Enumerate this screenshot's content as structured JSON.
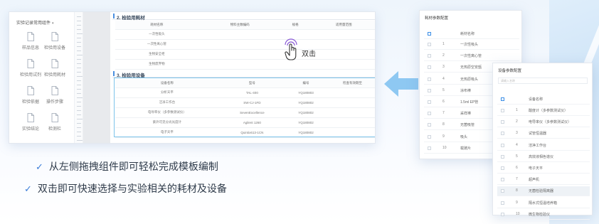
{
  "palette": {
    "title": "实验记录常用组件",
    "items": [
      {
        "label": "样品信息"
      },
      {
        "label": "检验用设备"
      },
      {
        "label": "检验用试剂"
      },
      {
        "label": "检验用耗材"
      },
      {
        "label": "检验依据"
      },
      {
        "label": "操作步骤"
      },
      {
        "label": "实验结论"
      },
      {
        "label": "检测栏"
      }
    ]
  },
  "doc": {
    "section2_title": "2. 检验用耗材",
    "section2_headers": [
      "耗材名称",
      "物料主数编码",
      "规格",
      "适用量范围"
    ],
    "section2_rows": [
      "一次性吸头",
      "一次性离心管",
      "生物安全柜",
      "生物废弃物"
    ],
    "section3_title": "3. 检验用设备",
    "section3_headers": [
      "设备名称",
      "型号",
      "编号",
      "检查有效期至"
    ],
    "section3_rows": [
      [
        "分析天平",
        "TAL-400",
        "YQ180803"
      ],
      [
        "洁净工作台",
        "SW-CJ-1FD",
        "YQ180802"
      ],
      [
        "电导率仪（多参数测试仪）",
        "SevenExcellence",
        "YQ180802"
      ],
      [
        "紫外可见分光光度计",
        "Agilent 1260",
        "YQ180802"
      ],
      [
        "电子天平",
        "Quintix613-1CN",
        "YQ180802"
      ]
    ]
  },
  "hint": {
    "dblclick_label": "双击"
  },
  "consumables_panel": {
    "title": "耗材参数配置",
    "header": "耗材名称",
    "items": [
      {
        "num": "1",
        "name": "一次性吸头"
      },
      {
        "num": "2",
        "name": "一次性离心管"
      },
      {
        "num": "3",
        "name": "无热原空安瓿"
      },
      {
        "num": "4",
        "name": "无热原吸头"
      },
      {
        "num": "5",
        "name": "涂布棒"
      },
      {
        "num": "6",
        "name": "1.5ml EP管"
      },
      {
        "num": "7",
        "name": "采样棒"
      },
      {
        "num": "8",
        "name": "无菌吸管"
      },
      {
        "num": "9",
        "name": "吸头"
      },
      {
        "num": "10",
        "name": "载玻片"
      }
    ]
  },
  "equipment_panel": {
    "title": "设备参数配置",
    "search_placeholder": "请输入名称",
    "header": "设备名称",
    "items": [
      {
        "num": "1",
        "name": "酸度计（多参数测试仪）"
      },
      {
        "num": "2",
        "name": "电导率仪（多参数测试仪）"
      },
      {
        "num": "3",
        "name": "试管恒温器"
      },
      {
        "num": "4",
        "name": "洁净工作台"
      },
      {
        "num": "5",
        "name": "高效液相色谱仪"
      },
      {
        "num": "6",
        "name": "电子天平"
      },
      {
        "num": "7",
        "name": "超声机"
      },
      {
        "num": "8",
        "name": "无菌检验隔离器"
      },
      {
        "num": "9",
        "name": "隔水式恒温培养箱"
      },
      {
        "num": "10",
        "name": "微生物检验仪"
      }
    ]
  },
  "features": [
    "从左侧拖拽组件即可轻松完成模板编制",
    "双击即可快速选择与实验相关的耗材及设备"
  ],
  "check_glyph": "✓",
  "colors": {
    "accent": "#3b7dd8",
    "selection": "#7cc3ea",
    "arrow": "#8ec8f2",
    "hand": "#8a5bd6"
  }
}
